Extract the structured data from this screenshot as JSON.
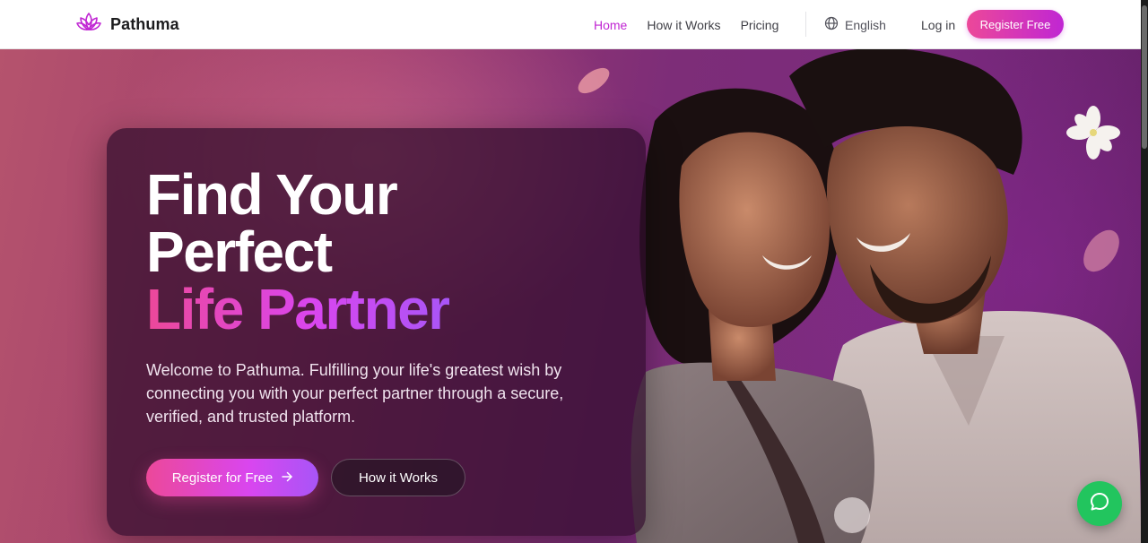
{
  "brand": {
    "name": "Pathuma",
    "logo_icon": "lotus-icon",
    "accent": "#c026d3"
  },
  "nav": {
    "links": [
      {
        "label": "Home",
        "active": true
      },
      {
        "label": "How it Works",
        "active": false
      },
      {
        "label": "Pricing",
        "active": false
      }
    ],
    "language": "English",
    "language_icon": "globe-icon",
    "login": "Log in",
    "register": "Register Free"
  },
  "hero": {
    "title_line1": "Find Your",
    "title_line2": "Perfect",
    "title_accent": "Life Partner",
    "description": "Welcome to Pathuma. Fulfilling your life's greatest wish by connecting you with your perfect partner through a secure, verified, and trusted platform.",
    "cta_primary": "Register for Free",
    "cta_primary_icon": "arrow-right-icon",
    "cta_secondary": "How it Works"
  },
  "chat": {
    "icon": "chat-bubble-icon",
    "color": "#22c55e"
  },
  "colors": {
    "gradient_start": "#ec4899",
    "gradient_end": "#a855f7"
  }
}
